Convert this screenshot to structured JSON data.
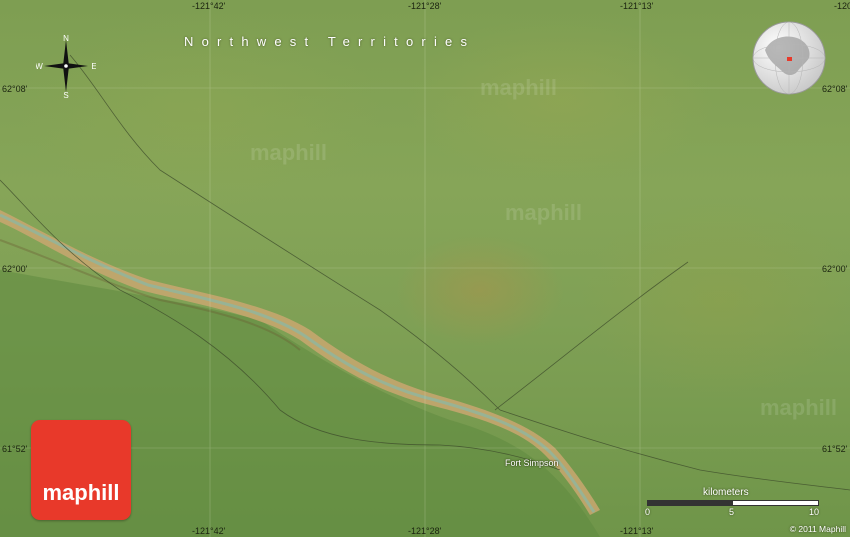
{
  "map": {
    "region_label": "Northwest Territories",
    "city_label": "Fort Simpson",
    "logo_text": "maphill",
    "copyright": "© 2011 Maphill",
    "compass": {
      "n": "N",
      "s": "S",
      "e": "E",
      "w": "W"
    },
    "lon_top": [
      "-121°42'",
      "-121°28'",
      "-121°13'"
    ],
    "lon_top_partial": "-120",
    "lon_bottom": [
      "-121°42'",
      "-121°28'",
      "-121°13'"
    ],
    "lat_left": [
      "62°08'",
      "62°00'",
      "61°52'"
    ],
    "lat_right": [
      "62°08'",
      "62°00'",
      "61°52'"
    ],
    "scale": {
      "title": "kilometers",
      "ticks": [
        "0",
        "5",
        "10"
      ]
    }
  }
}
